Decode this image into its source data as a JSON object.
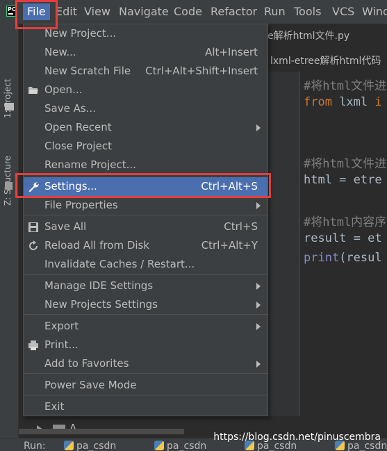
{
  "menubar": {
    "items": [
      "File",
      "Edit",
      "View",
      "Navigate",
      "Code",
      "Refactor",
      "Run",
      "Tools",
      "VCS",
      "Wind"
    ]
  },
  "left_strip": {
    "project_tab": "1: Project",
    "structure_tab": "Z: Structure"
  },
  "editor": {
    "tab_title": "e解析html文件.py",
    "breadcrumb": "lxml-etree解析html代码",
    "lines": [
      {
        "kind": "comment",
        "text": "#将html文件进"
      },
      {
        "kind": "import",
        "kw": "from",
        "rest": " lxml ",
        "kw2": "i"
      },
      {
        "kind": "blank",
        "text": ""
      },
      {
        "kind": "comment",
        "text": "#将html文件进"
      },
      {
        "kind": "plain",
        "text": "html = etre"
      },
      {
        "kind": "comment",
        "text": "#将html内容序"
      },
      {
        "kind": "plain",
        "text": "result = et"
      },
      {
        "kind": "print",
        "fn": "print",
        "rest": "(resul"
      }
    ]
  },
  "project_tree": {
    "label": "A"
  },
  "run_bar": {
    "label": "Run:",
    "tabs": [
      "pa_csdn",
      "pa_csdn",
      "pa_csdn",
      "pa_csdn"
    ]
  },
  "watermark": "https://blog.csdn.net/pinuscembra",
  "file_menu": {
    "items": [
      {
        "label": "New Project...",
        "shortcut": "",
        "submenu": false,
        "icon": ""
      },
      {
        "label": "New...",
        "shortcut": "Alt+Insert",
        "submenu": false,
        "icon": ""
      },
      {
        "label": "New Scratch File",
        "shortcut": "Ctrl+Alt+Shift+Insert",
        "submenu": false,
        "icon": ""
      },
      {
        "label": "Open...",
        "shortcut": "",
        "submenu": false,
        "icon": "folder-open-icon"
      },
      {
        "label": "Save As...",
        "shortcut": "",
        "submenu": false,
        "icon": ""
      },
      {
        "label": "Open Recent",
        "shortcut": "",
        "submenu": true,
        "icon": ""
      },
      {
        "label": "Close Project",
        "shortcut": "",
        "submenu": false,
        "icon": ""
      },
      {
        "label": "Rename Project...",
        "shortcut": "",
        "submenu": false,
        "icon": ""
      },
      {
        "label": "Settings...",
        "shortcut": "Ctrl+Alt+S",
        "submenu": false,
        "icon": "wrench-icon",
        "selected": true
      },
      {
        "label": "File Properties",
        "shortcut": "",
        "submenu": true,
        "icon": ""
      },
      {
        "label": "Save All",
        "shortcut": "Ctrl+S",
        "submenu": false,
        "icon": "save-icon"
      },
      {
        "label": "Reload All from Disk",
        "shortcut": "Ctrl+Alt+Y",
        "submenu": false,
        "icon": "reload-icon"
      },
      {
        "label": "Invalidate Caches / Restart...",
        "shortcut": "",
        "submenu": false,
        "icon": ""
      },
      {
        "label": "Manage IDE Settings",
        "shortcut": "",
        "submenu": true,
        "icon": ""
      },
      {
        "label": "New Projects Settings",
        "shortcut": "",
        "submenu": true,
        "icon": ""
      },
      {
        "label": "Export",
        "shortcut": "",
        "submenu": true,
        "icon": ""
      },
      {
        "label": "Print...",
        "shortcut": "",
        "submenu": false,
        "icon": "print-icon"
      },
      {
        "label": "Add to Favorites",
        "shortcut": "",
        "submenu": true,
        "icon": ""
      },
      {
        "label": "Power Save Mode",
        "shortcut": "",
        "submenu": false,
        "icon": ""
      },
      {
        "label": "Exit",
        "shortcut": "",
        "submenu": false,
        "icon": ""
      }
    ]
  },
  "colors": {
    "selection": "#4b6eaf",
    "highlight_box": "#e33e3e",
    "menu_bg": "#3c3f41"
  }
}
